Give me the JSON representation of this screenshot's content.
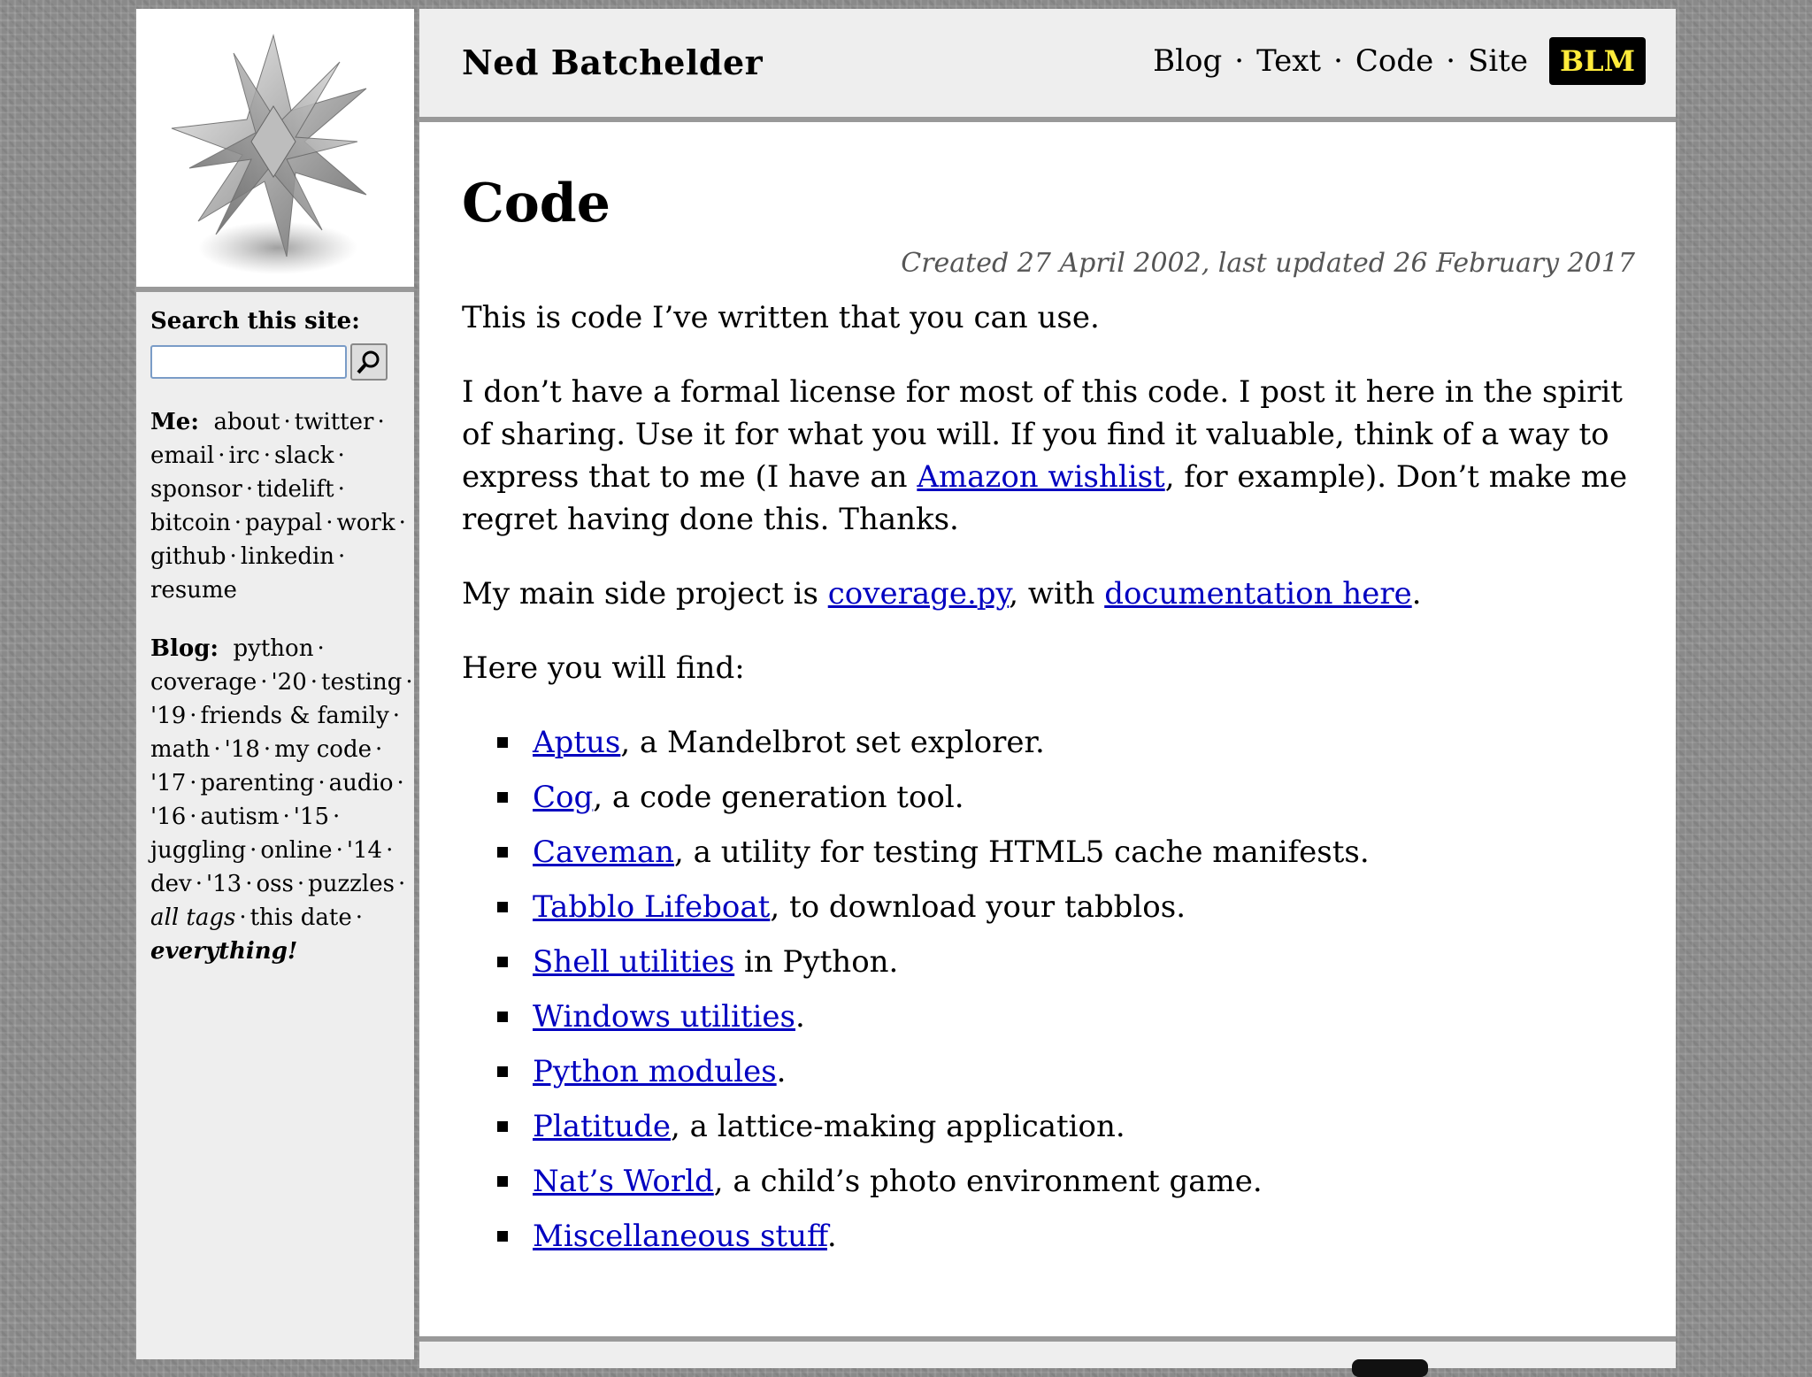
{
  "header": {
    "site_name": "Ned Batchelder",
    "nav": [
      "Blog",
      "Text",
      "Code",
      "Site"
    ],
    "nav_sep": "·",
    "blm": "BLM"
  },
  "sidebar": {
    "search_title": "Search this site:",
    "search_placeholder": "",
    "me_label": "Me:",
    "me_links": [
      "about",
      "twitter",
      "email",
      "irc",
      "slack",
      "sponsor",
      "tidelift",
      "bitcoin",
      "paypal",
      "work",
      "github",
      "linkedin",
      "resume"
    ],
    "blog_label": "Blog:",
    "blog_links": [
      "python",
      "coverage",
      "'20",
      "testing",
      "'19",
      "friends & family",
      "math",
      "'18",
      "my code",
      "'17",
      "parenting",
      "audio",
      "'16",
      "autism",
      "'15",
      "juggling",
      "online",
      "'14",
      "dev",
      "'13",
      "oss",
      "puzzles"
    ],
    "all_tags": "all tags",
    "this_date": "this date",
    "everything": "everything!",
    "sep": "·"
  },
  "main": {
    "title": "Code",
    "dates": "Created 27 April 2002, last updated 26 February 2017",
    "p1": "This is code I’ve written that you can use.",
    "p2_a": "I don’t have a formal license for most of this code. I post it here in the spirit of sharing. Use it for what you will. If you find it valuable, think of a way to express that to me (I have an ",
    "p2_link": "Amazon wishlist",
    "p2_b": ", for example). Don’t make me regret having done this. Thanks.",
    "p3_a": "My main side project is ",
    "p3_link1": "coverage.py",
    "p3_b": ", with ",
    "p3_link2": "documentation here",
    "p3_c": ".",
    "p4": "Here you will find:",
    "items": [
      {
        "link": "Aptus",
        "rest": ", a Mandelbrot set explorer."
      },
      {
        "link": "Cog",
        "rest": ", a code generation tool."
      },
      {
        "link": "Caveman",
        "rest": ", a utility for testing HTML5 cache manifests."
      },
      {
        "link": "Tabblo Lifeboat",
        "rest": ", to download your tabblos."
      },
      {
        "link": "Shell utilities",
        "rest": " in Python."
      },
      {
        "link": "Windows utilities",
        "rest": "."
      },
      {
        "link": "Python modules",
        "rest": "."
      },
      {
        "link": "Platitude",
        "rest": ", a lattice-making application."
      },
      {
        "link": "Nat’s World",
        "rest": ", a child’s photo environment game."
      },
      {
        "link": "Miscellaneous stuff",
        "rest": "."
      }
    ]
  }
}
